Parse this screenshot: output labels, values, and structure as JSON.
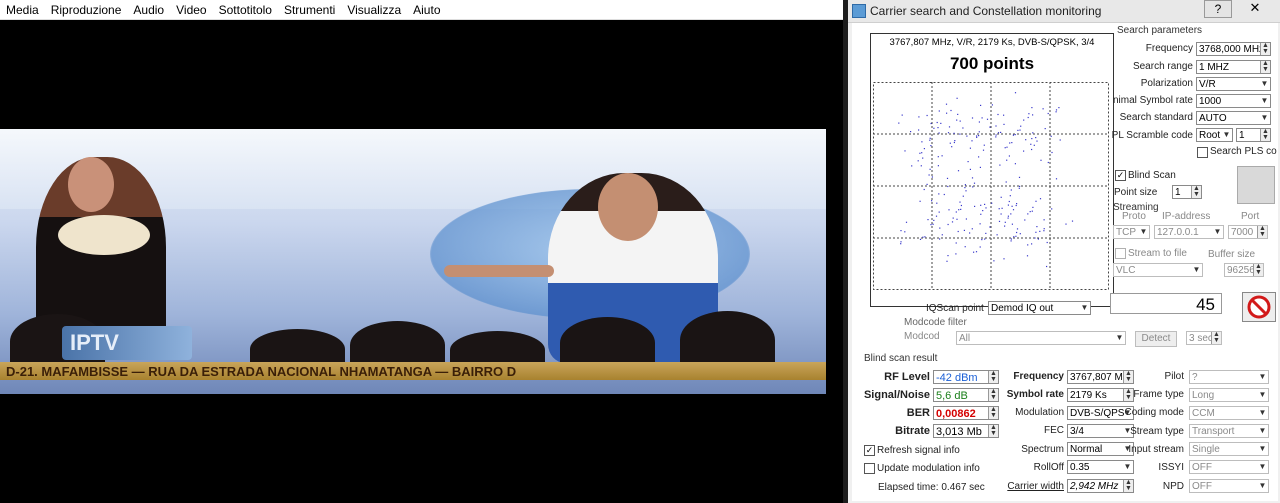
{
  "vlc": {
    "menu": [
      "Media",
      "Riproduzione",
      "Audio",
      "Video",
      "Sottotitolo",
      "Strumenti",
      "Visualizza",
      "Aiuto"
    ],
    "video": {
      "logo_text": "IPTV",
      "ticker": "D-21.   MAFAMBISSE — RUA DA ESTRADA NACIONAL   NHAMATANGA — BAIRRO D"
    }
  },
  "dialog": {
    "title": "Carrier search and Constellation monitoring",
    "help": "?",
    "close": "✕",
    "constellation": {
      "info": "3767,807 MHz, V/R, 2179 Ks, DVB-S/QPSK, 3/4",
      "points": "700 points",
      "dot_color": "#3a3acb"
    },
    "search": {
      "group": "Search parameters",
      "frequency_label": "Frequency",
      "frequency_value": "3768,000 MHz",
      "range_label": "Search range",
      "range_value": "1 MHZ",
      "polarization_label": "Polarization",
      "polarization_value": "V/R",
      "symbol_label": "nimal Symbol rate",
      "symbol_value": "1000",
      "standard_label": "Search standard",
      "standard_value": "AUTO",
      "pl_label": "PL Scramble code",
      "pl_mode": "Root",
      "pl_value": "1",
      "search_pls": "Search PLS co"
    },
    "blind": {
      "blind_scan": "Blind Scan",
      "point_size_label": "Point size",
      "point_size_value": "1"
    },
    "streaming": {
      "group": "Streaming",
      "proto_label": "Proto",
      "ip_label": "IP-address",
      "port_label": "Port",
      "proto_value": "TCP",
      "ip_value": "127.0.0.1",
      "port_value": "7000",
      "stream_to_file": "Stream to file",
      "buffer_label": "Buffer size",
      "player_value": "VLC",
      "buffer_value": "96256"
    },
    "iqscan": {
      "label": "IQScan point",
      "value": "Demod IQ out",
      "counter": "45"
    },
    "modcode": {
      "group": "Modcode filter",
      "label": "Modcod",
      "value": "All",
      "detect": "Detect",
      "sec_value": "3 sec"
    },
    "result": {
      "group": "Blind scan result",
      "rf_label": "RF Level",
      "rf_value": "-42 dBm",
      "sn_label": "Signal/Noise",
      "sn_value": "5,6 dB",
      "ber_label": "BER",
      "ber_value": "0,00862",
      "bitrate_label": "Bitrate",
      "bitrate_value": "3,013 Mb",
      "freq_label": "Frequency",
      "freq_value": "3767,807 M",
      "sr_label": "Symbol rate",
      "sr_value": "2179 Ks",
      "mod_label": "Modulation",
      "mod_value": "DVB-S/QPS",
      "fec_label": "FEC",
      "fec_value": "3/4",
      "spectrum_label": "Spectrum",
      "spectrum_value": "Normal",
      "rolloff_label": "RollOff",
      "rolloff_value": "0.35",
      "carrier_label": "Carrier width",
      "carrier_value": "2,942 MHz",
      "pilot_label": "Pilot",
      "pilot_value": "?",
      "frame_label": "Frame type",
      "frame_value": "Long",
      "coding_label": "Coding mode",
      "coding_value": "CCM",
      "stream_label": "Stream type",
      "stream_value": "Transport",
      "input_label": "Input stream",
      "input_value": "Single",
      "issyi_label": "ISSYI",
      "issyi_value": "OFF",
      "npd_label": "NPD",
      "npd_value": "OFF",
      "refresh": "Refresh signal info",
      "update": "Update modulation info",
      "elapsed": "Elapsed time: 0.467 sec"
    }
  }
}
